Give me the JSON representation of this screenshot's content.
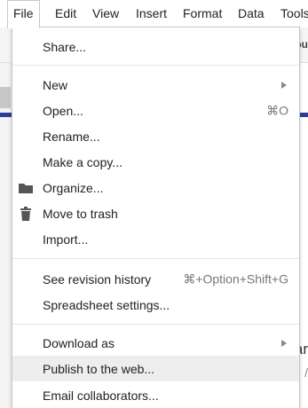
{
  "menubar": {
    "items": [
      {
        "label": "File",
        "active": true
      },
      {
        "label": "Edit"
      },
      {
        "label": "View"
      },
      {
        "label": "Insert"
      },
      {
        "label": "Format"
      },
      {
        "label": "Data"
      },
      {
        "label": "Tools"
      }
    ]
  },
  "background": {
    "toolbar_fragment": "ou",
    "right_fragment_1": "ar",
    "right_fragment_2": "/"
  },
  "file_menu": {
    "share": "Share...",
    "new": "New",
    "open": "Open...",
    "open_shortcut": "⌘O",
    "rename": "Rename...",
    "make_copy": "Make a copy...",
    "organize": "Organize...",
    "move_to_trash": "Move to trash",
    "import": "Import...",
    "revision_history": "See revision history",
    "revision_history_shortcut": "⌘+Option+Shift+G",
    "spreadsheet_settings": "Spreadsheet settings...",
    "download_as": "Download as",
    "publish": "Publish to the web...",
    "email_collaborators": "Email collaborators..."
  },
  "colors": {
    "hover_background": "#eeeeee",
    "accent_strip": "#2f3d99"
  },
  "icons": {
    "organize": "folder-icon",
    "move_to_trash": "trash-icon",
    "submenu": "submenu-arrow-icon"
  }
}
